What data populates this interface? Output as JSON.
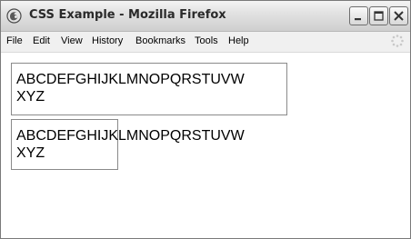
{
  "window": {
    "title": "CSS Example - Mozilla Firefox",
    "app_icon": "firefox-icon",
    "controls": [
      "minimize-icon",
      "maximize-icon",
      "close-icon"
    ]
  },
  "menu": {
    "items": [
      "File",
      "Edit",
      "View",
      "History",
      "Bookmarks",
      "Tools",
      "Help"
    ],
    "throbber_icon": "loading-throbber-icon"
  },
  "content": {
    "box1_text": "ABCDEFGHIJKLMNOPQRSTUVW\nXYZ",
    "box2_text": "ABCDEFGHIJKLMNOPQRSTUVW\nXYZ"
  }
}
